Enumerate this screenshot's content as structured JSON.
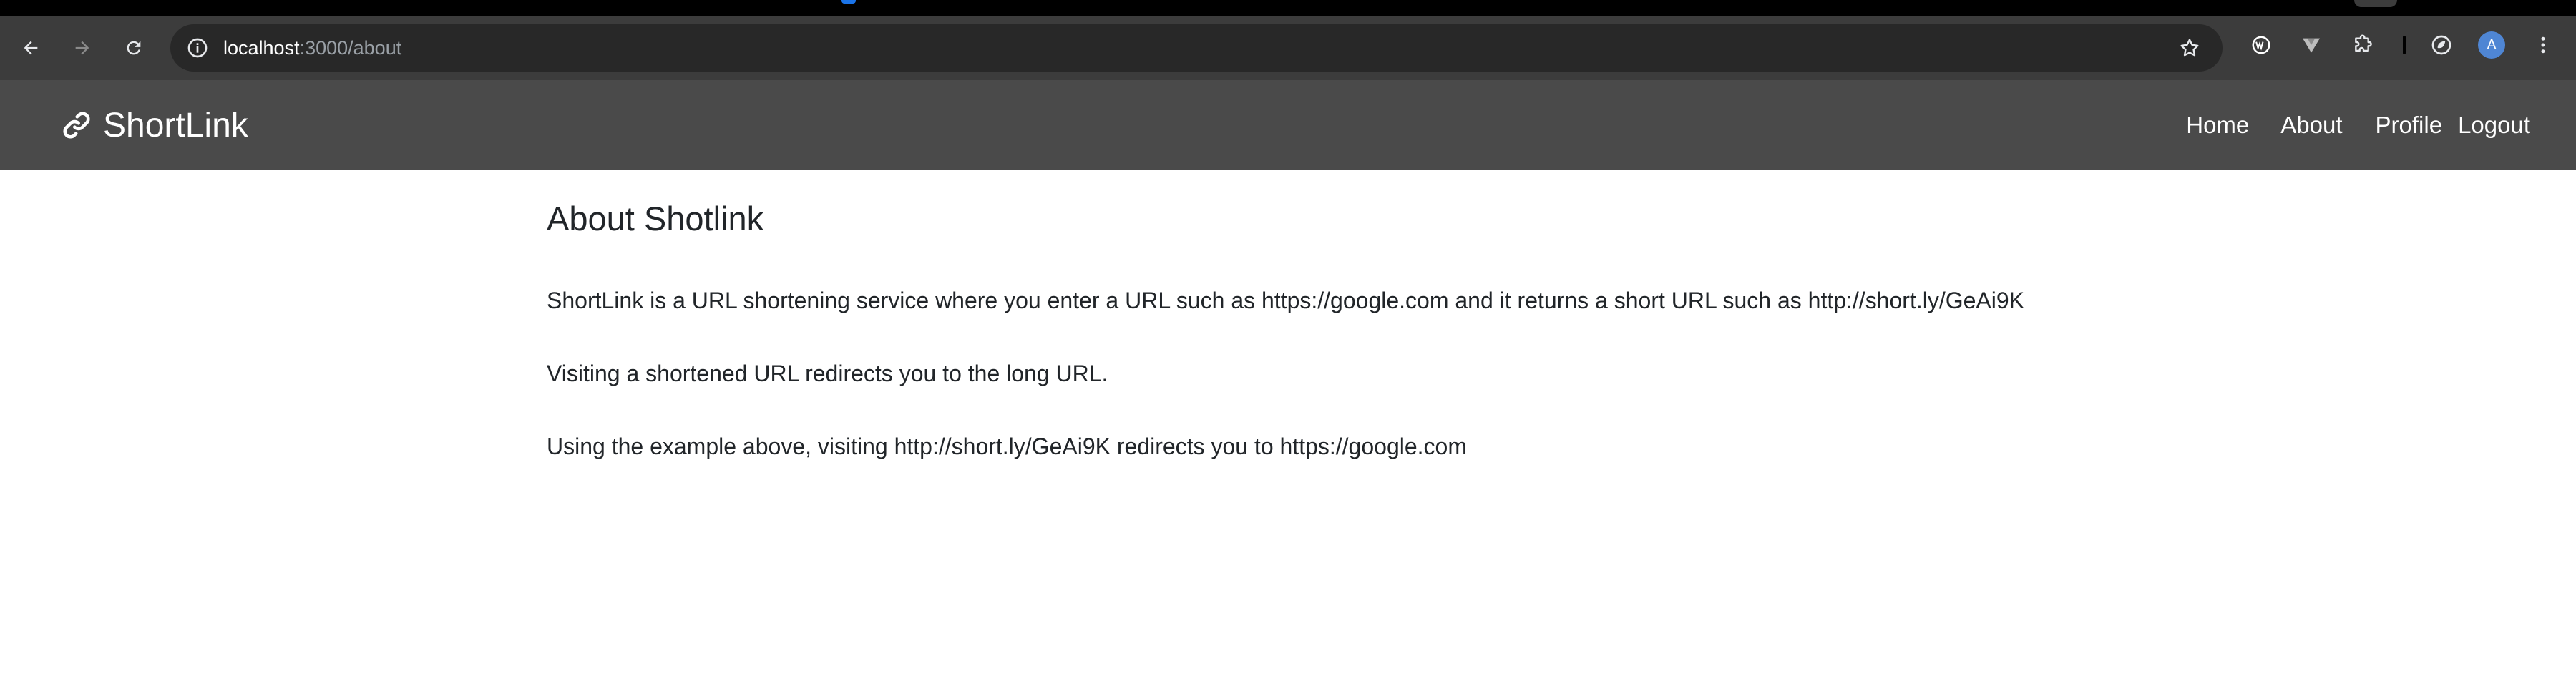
{
  "browser": {
    "address_host": "localhost",
    "address_path": ":3000/about",
    "avatar_initial": "A",
    "accent_color": "#1a73e8"
  },
  "navbar": {
    "brand": "ShortLink",
    "brand_icon": "link-icon",
    "links": [
      "Home",
      "About",
      "Profile",
      "Logout"
    ],
    "background": "#4a4a4a"
  },
  "main": {
    "title": "About Shotlink",
    "paragraphs": [
      "ShortLink is a URL shortening service where you enter a URL such as https://google.com and it returns a short URL such as http://short.ly/GeAi9K",
      "Visiting a shortened URL redirects you to the long URL.",
      "Using the example above, visiting http://short.ly/GeAi9K redirects you to https://google.com"
    ]
  }
}
